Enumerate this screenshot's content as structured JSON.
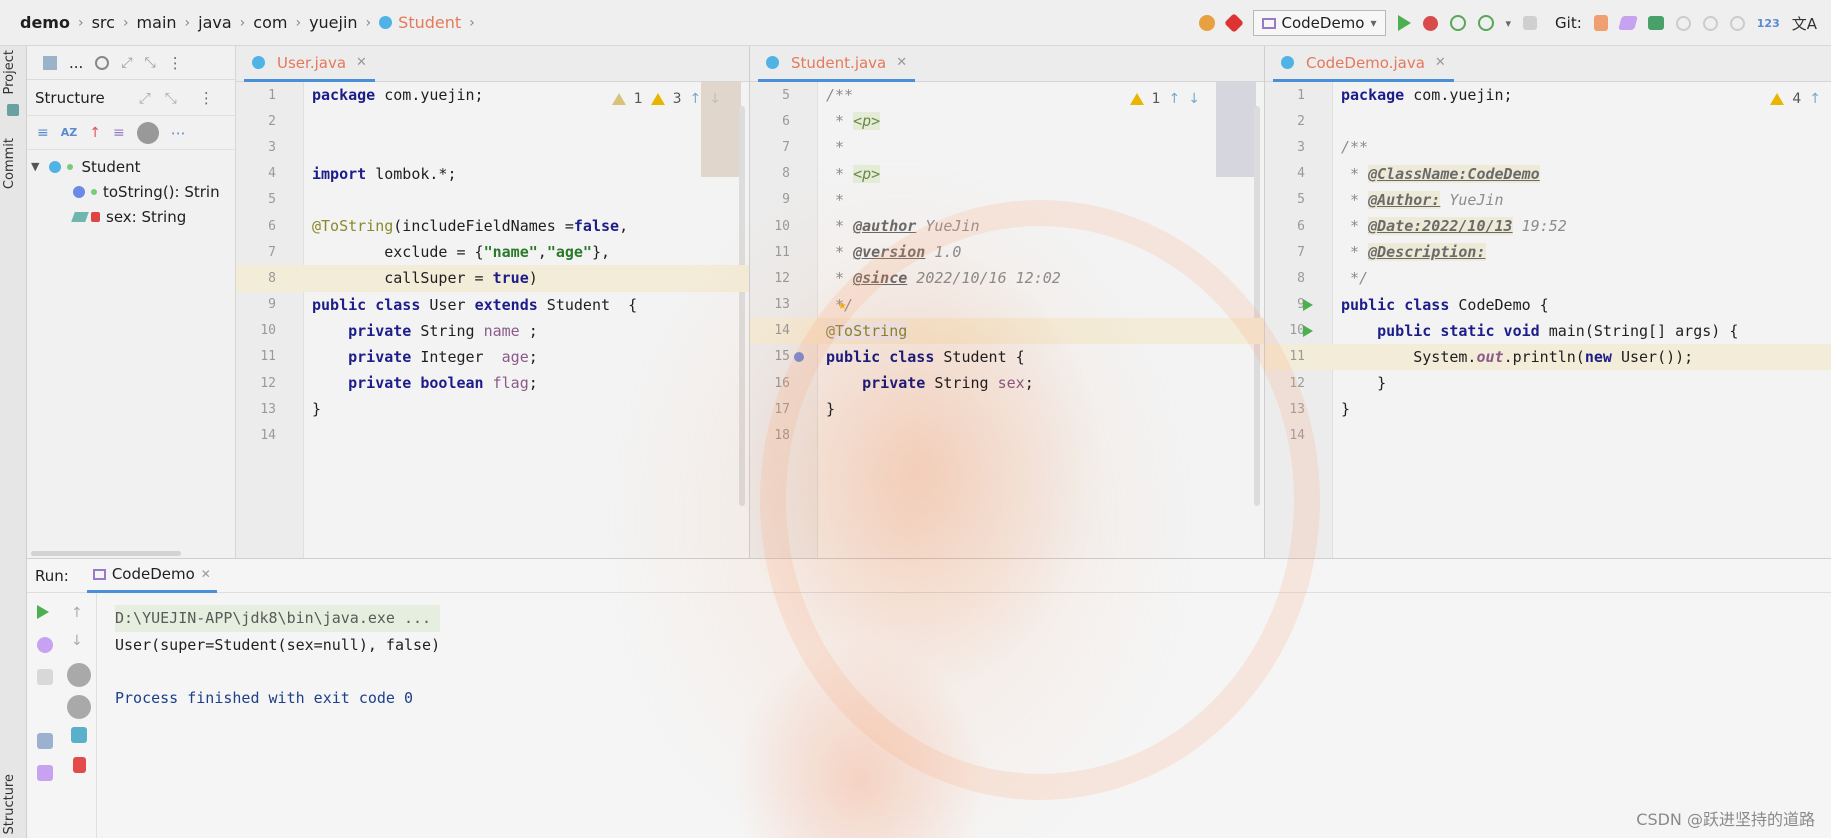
{
  "breadcrumb": {
    "items": [
      "demo",
      "src",
      "main",
      "java",
      "com",
      "yuejin"
    ],
    "active": "Student"
  },
  "toolbar": {
    "run_config": "CodeDemo",
    "git_label": "Git:"
  },
  "left_strip": {
    "project": "Project",
    "commit": "Commit",
    "structure": "Structure"
  },
  "structure_panel": {
    "tab_label": "...",
    "title": "Structure",
    "tree": [
      {
        "label": "Student"
      },
      {
        "label": "toString(): Strin"
      },
      {
        "label": "sex: String"
      }
    ]
  },
  "editor_user": {
    "tab": "User.java",
    "warn1": "1",
    "warn3": "3",
    "lines": [
      "1",
      "2",
      "3",
      "4",
      "5",
      "6",
      "7",
      "8",
      "9",
      "10",
      "11",
      "12",
      "13",
      "14"
    ],
    "code": {
      "l1_kw": "package",
      "l1_rest": " com.yuejin;",
      "l4_kw": "import",
      "l4_rest": " lombok.*;",
      "l6_an": "@ToString",
      "l6_a": "(includeFieldNames =",
      "l6_kw": "false",
      "l6_b": ",",
      "l7_a": "        exclude = {",
      "l7_s1": "\"name\"",
      "l7_c": ",",
      "l7_s2": "\"age\"",
      "l7_b": "},",
      "l8_a": "        callSuper = ",
      "l8_kw": "true",
      "l8_b": ")",
      "l9_kw1": "public class",
      "l9_a": " User ",
      "l9_kw2": "extends",
      "l9_b": " Student  {",
      "l10_kw": "    private",
      "l10_a": " String ",
      "l10_f": "name",
      "l10_b": " ;",
      "l11_kw": "    private",
      "l11_a": " Integer  ",
      "l11_f": "age",
      "l11_b": ";",
      "l12_kw": "    private boolean",
      "l12_f": " flag",
      "l12_b": ";",
      "l13": "}"
    }
  },
  "editor_student": {
    "tab": "Student.java",
    "warn": "1",
    "lines": [
      "5",
      "6",
      "7",
      "8",
      "9",
      "10",
      "11",
      "12",
      "13",
      "14",
      "15",
      "16",
      "17",
      "18"
    ],
    "code": {
      "l5": "/**",
      "l6_a": " * ",
      "l6_t": "<p>",
      "l7": " *",
      "l8_a": " * ",
      "l8_t": "<p>",
      "l9": " *",
      "l10_a": " * ",
      "l10_d": "@author",
      "l10_b": " YueJin",
      "l11_a": " * ",
      "l11_d": "@version",
      "l11_b": " 1.0",
      "l12_a": " * ",
      "l12_d": "@since",
      "l12_b": " 2022/10/16 12:02",
      "l13": " */",
      "l14": "@ToString",
      "l15_kw": "public class",
      "l15_b": " Student {",
      "l16_kw": "    private",
      "l16_a": " String ",
      "l16_f": "sex",
      "l16_b": ";",
      "l17": "}"
    }
  },
  "editor_codedemo": {
    "tab": "CodeDemo.java",
    "warn": "4",
    "lines": [
      "1",
      "2",
      "3",
      "4",
      "5",
      "6",
      "7",
      "8",
      "9",
      "10",
      "11",
      "12",
      "13",
      "14"
    ],
    "code": {
      "l1_kw": "package",
      "l1_rest": " com.yuejin;",
      "l3": "/**",
      "l4_a": " * ",
      "l4_d": "@ClassName:CodeDemo",
      "l5_a": " * ",
      "l5_d": "@Author:",
      "l5_b": " YueJin",
      "l6_a": " * ",
      "l6_d": "@Date:2022/10/13",
      "l6_b": " 19:52",
      "l7_a": " * ",
      "l7_d": "@Description:",
      "l8": " */",
      "l9_kw": "public class",
      "l9_b": " CodeDemo {",
      "l10_kw": "    public static void",
      "l10_b": " main(String[] args) {",
      "l11_a": "        System.",
      "l11_f": "out",
      "l11_b": ".println(",
      "l11_kw": "new",
      "l11_c": " User());",
      "l12": "    }",
      "l13": "}"
    }
  },
  "run_panel": {
    "label": "Run:",
    "tab": "CodeDemo",
    "console": {
      "path": "D:\\YUEJIN-APP\\jdk8\\bin\\java.exe ...",
      "output": "User(super=Student(sex=null), false)",
      "finished": "Process finished with exit code 0"
    }
  },
  "watermark": "CSDN @跃进坚持的道路",
  "colors": {
    "accent": "#4a90d9",
    "active_tab": "#e4795b",
    "keyword": "#1d1d8a",
    "warning": "#e8b500"
  }
}
